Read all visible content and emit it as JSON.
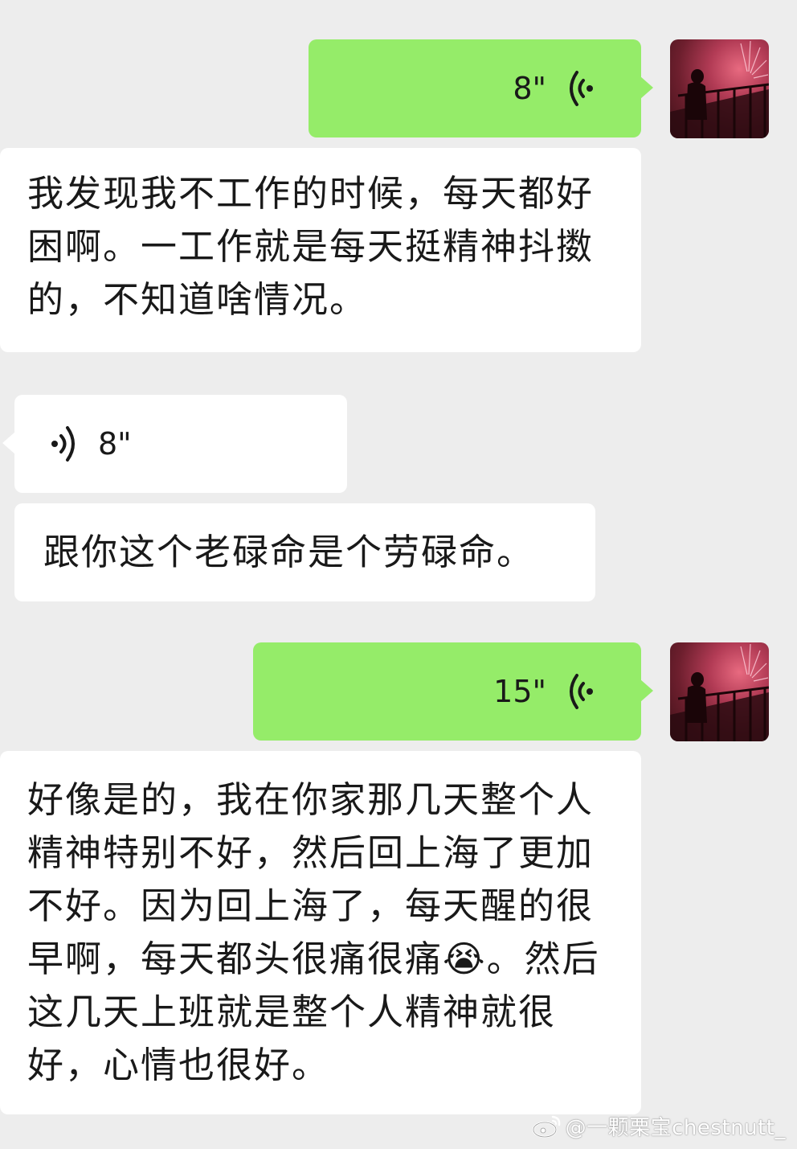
{
  "messages": [
    {
      "side": "sent",
      "type": "voice",
      "duration": "8\""
    },
    {
      "side": "sent",
      "type": "voice_transcript",
      "text": "我发现我不工作的时候，每天都好困啊。一工作就是每天挺精神抖擞的，不知道啥情况。"
    },
    {
      "side": "received",
      "type": "voice",
      "duration": "8\""
    },
    {
      "side": "received",
      "type": "voice_transcript",
      "text": "跟你这个老碌命是个劳碌命。"
    },
    {
      "side": "sent",
      "type": "voice",
      "duration": "15\""
    },
    {
      "side": "sent",
      "type": "voice_transcript",
      "text": "好像是的，我在你家那几天整个人精神特别不好，然后回上海了更加不好。因为回上海了，每天醒的很早啊，每天都头很痛很痛😭。然后这几天上班就是整个人精神就很好，心情也很好。"
    }
  ],
  "watermark": "@一颗栗宝chestnutt_",
  "colors": {
    "background": "#ededed",
    "sent_bubble": "#95ec69",
    "received_bubble": "#ffffff",
    "text": "#191919"
  },
  "icons": {
    "voice_wave": "voice-wave-icon",
    "avatar": "user-avatar",
    "weibo": "weibo-logo-icon"
  }
}
